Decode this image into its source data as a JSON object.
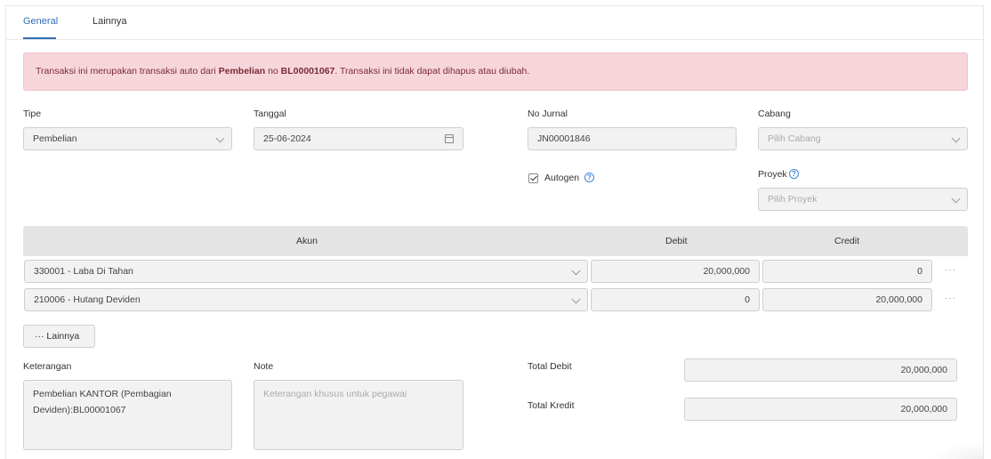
{
  "tabs": {
    "general": "General",
    "lainnya": "Lainnya"
  },
  "alert": {
    "prefix": "Transaksi ini merupakan transaksi auto dari ",
    "source": "Pembelian",
    "mid": " no ",
    "number": "BL00001067",
    "suffix": ". Transaksi ini tidak dapat dihapus atau diubah."
  },
  "form": {
    "tipe_label": "Tipe",
    "tipe_value": "Pembelian",
    "tanggal_label": "Tanggal",
    "tanggal_value": "25-06-2024",
    "no_jurnal_label": "No Jurnal",
    "no_jurnal_value": "JN00001846",
    "cabang_label": "Cabang",
    "cabang_placeholder": "Pilih Cabang",
    "autogen_label": "Autogen",
    "autogen_checked": true,
    "proyek_label": "Proyek",
    "proyek_placeholder": "Pilih Proyek"
  },
  "table": {
    "headers": {
      "akun": "Akun",
      "debit": "Debit",
      "credit": "Credit"
    },
    "rows": [
      {
        "akun": "330001 - Laba Di Tahan",
        "debit": "20,000,000",
        "credit": "0"
      },
      {
        "akun": "210006 - Hutang Deviden",
        "debit": "0",
        "credit": "20,000,000"
      }
    ],
    "row_menu": "···",
    "more_button": "··· Lainnya"
  },
  "bottom": {
    "keterangan_label": "Keterangan",
    "keterangan_value": "Pembelian KANTOR (Pembagian Deviden):BL00001067",
    "note_label": "Note",
    "note_placeholder": "Keterangan khusus untuk pegawai",
    "total_debit_label": "Total Debit",
    "total_debit_value": "20,000,000",
    "total_kredit_label": "Total Kredit",
    "total_kredit_value": "20,000,000"
  },
  "icons": {
    "calendar": "calendar-icon",
    "chevron": "chevron-down-icon",
    "help": "question-circle-icon",
    "checkbox": "checkbox-checked-icon"
  },
  "colors": {
    "accent": "#2f6db5",
    "alert_bg": "#f7d6db",
    "alert_text": "#7a2b36",
    "field_bg": "#f2f2f2",
    "table_header_bg": "#e4e4e4"
  }
}
